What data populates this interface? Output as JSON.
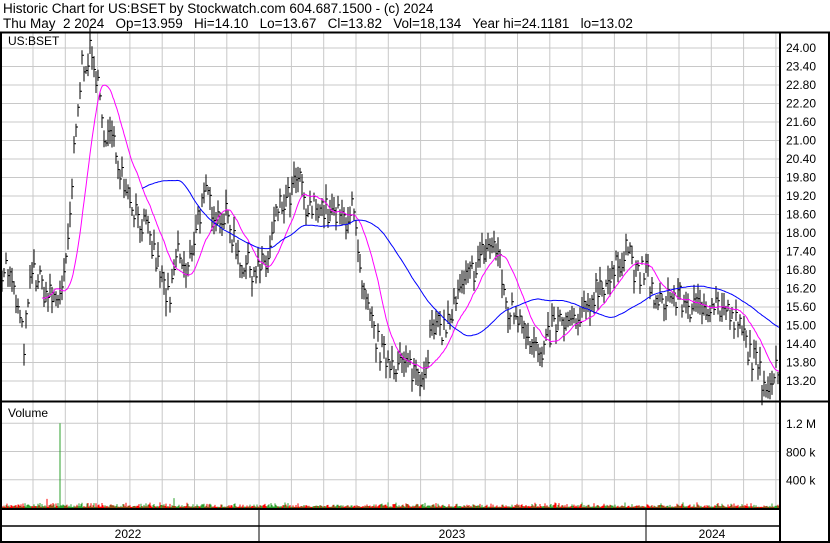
{
  "header": {
    "line1": "Historic Chart for US:BSET by Stockwatch.com 604.687.1500 - (c) 2024",
    "line2": "Thu May  2 2024   Op=13.959   Hi=14.10   Lo=13.67   Cl=13.82   Vol=18,134   Year hi=24.1181   lo=13.02"
  },
  "colors": {
    "price": "#000000",
    "ma_short": "#ff00ff",
    "ma_long": "#0000ff",
    "vol_up": "#2ca02c",
    "vol_down": "#ff0000",
    "grid": "#c8c8c8"
  },
  "chart_data": {
    "type": "line",
    "title": "US:BSET",
    "volume_label": "Volume",
    "x_unit": "trading-period index",
    "ylim": [
      12.9,
      24.3
    ],
    "y_ticks": [
      "24.00",
      "23.40",
      "22.80",
      "22.20",
      "21.60",
      "21.00",
      "20.40",
      "19.80",
      "19.20",
      "18.60",
      "18.00",
      "17.40",
      "16.80",
      "16.20",
      "15.60",
      "15.00",
      "14.40",
      "13.80",
      "13.20"
    ],
    "volume_ticks": [
      "1.2 M",
      "800 k",
      "400 k"
    ],
    "volume_tick_values": [
      1200000,
      800000,
      400000
    ],
    "volume_max": 1500000,
    "year_labels": [
      "2022",
      "2023",
      "2024"
    ],
    "price_waypoints": [
      [
        0,
        16.9
      ],
      [
        5,
        16.9
      ],
      [
        15,
        15.6
      ],
      [
        22,
        14.4
      ],
      [
        30,
        16.8
      ],
      [
        45,
        16.0
      ],
      [
        55,
        15.8
      ],
      [
        65,
        17.0
      ],
      [
        72,
        20.5
      ],
      [
        80,
        23.5
      ],
      [
        88,
        23.8
      ],
      [
        95,
        23.0
      ],
      [
        100,
        21.5
      ],
      [
        110,
        21.0
      ],
      [
        120,
        20.0
      ],
      [
        130,
        19.0
      ],
      [
        145,
        18.0
      ],
      [
        160,
        16.5
      ],
      [
        168,
        15.6
      ],
      [
        175,
        17.5
      ],
      [
        185,
        16.5
      ],
      [
        195,
        18.5
      ],
      [
        205,
        19.2
      ],
      [
        215,
        18.6
      ],
      [
        225,
        18.5
      ],
      [
        240,
        17.0
      ],
      [
        255,
        16.8
      ],
      [
        265,
        17.0
      ],
      [
        275,
        18.7
      ],
      [
        285,
        19.0
      ],
      [
        297,
        19.8
      ],
      [
        305,
        18.5
      ],
      [
        315,
        19.0
      ],
      [
        330,
        18.5
      ],
      [
        345,
        18.5
      ],
      [
        350,
        19.0
      ],
      [
        360,
        16.0
      ],
      [
        370,
        15.0
      ],
      [
        380,
        14.0
      ],
      [
        395,
        13.8
      ],
      [
        410,
        13.6
      ],
      [
        420,
        13.4
      ],
      [
        430,
        14.8
      ],
      [
        445,
        15.0
      ],
      [
        455,
        15.8
      ],
      [
        465,
        16.5
      ],
      [
        475,
        17.0
      ],
      [
        485,
        17.6
      ],
      [
        495,
        17.5
      ],
      [
        505,
        15.5
      ],
      [
        520,
        15.3
      ],
      [
        530,
        14.5
      ],
      [
        540,
        13.8
      ],
      [
        550,
        15.0
      ],
      [
        560,
        15.1
      ],
      [
        575,
        15.0
      ],
      [
        585,
        15.5
      ],
      [
        595,
        16.3
      ],
      [
        610,
        16.5
      ],
      [
        625,
        17.7
      ],
      [
        635,
        16.5
      ],
      [
        645,
        16.8
      ],
      [
        655,
        15.5
      ],
      [
        665,
        16.0
      ],
      [
        680,
        15.8
      ],
      [
        695,
        15.5
      ],
      [
        710,
        15.8
      ],
      [
        725,
        15.4
      ],
      [
        740,
        14.8
      ],
      [
        750,
        14.0
      ],
      [
        760,
        13.3
      ],
      [
        770,
        13.2
      ],
      [
        777,
        13.9
      ]
    ],
    "volume_spikes": [
      [
        58,
        1200000
      ],
      [
        45,
        130000
      ],
      [
        172,
        140000
      ],
      [
        100,
        70000
      ],
      [
        455,
        60000
      ]
    ]
  }
}
